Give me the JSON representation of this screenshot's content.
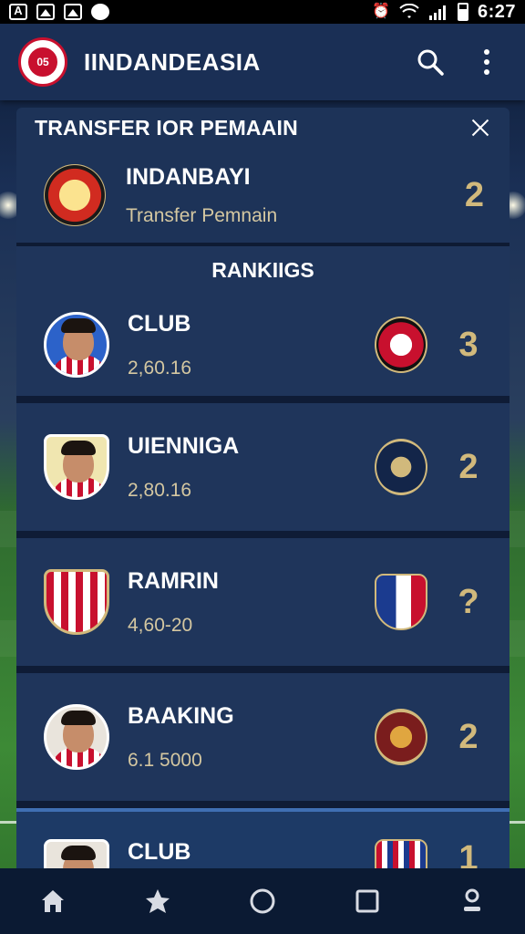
{
  "status_bar": {
    "time": "6:27",
    "icons": [
      "text-a-icon",
      "image-icon",
      "gallery-icon",
      "shield-icon",
      "alarm-icon",
      "wifi-icon",
      "signal-icon",
      "battery-icon"
    ]
  },
  "app_bar": {
    "title": "IINDANDEASIA",
    "logo_text": "05",
    "actions": [
      "search-icon",
      "more-vert-icon"
    ]
  },
  "panel": {
    "title": "TRANSFER IOR PEMAAIN",
    "transfer": {
      "name": "INDANBAYI",
      "subtitle": "Transfer Pemnain",
      "number": "2"
    },
    "rankings_label": "RANKIIGS",
    "rows": [
      {
        "name": "CLUB",
        "value": "2,60.16",
        "number": "3"
      },
      {
        "name": "UIENNIGA",
        "value": "2,80.16",
        "number": "2"
      },
      {
        "name": "RAMRIN",
        "value": "4,60-20",
        "number": "?"
      },
      {
        "name": "BAAKING",
        "value": "6.1 5000",
        "number": "2"
      },
      {
        "name": "CLUB",
        "value": "",
        "number": "1"
      }
    ]
  },
  "bottom_nav": [
    "home-icon",
    "star-icon",
    "circle-icon",
    "square-icon",
    "profile-icon"
  ],
  "colors": {
    "appbar": "#1a2f55",
    "card": "#1f355b",
    "accent_gold": "#d1b97c",
    "club_red": "#c8102e"
  }
}
